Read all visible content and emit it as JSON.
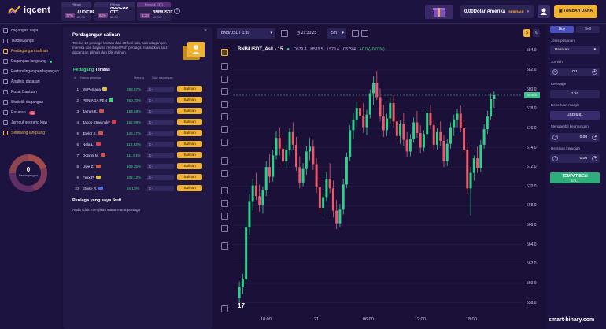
{
  "brand": {
    "name": "iqcent"
  },
  "asset_tabs": [
    {
      "header": "Pilihan",
      "pct": "77%",
      "name": "AUD/CHF",
      "sub": "60.00"
    },
    {
      "header": "Pilihan",
      "pct": "62%",
      "name": "AUD/CAD OTC",
      "sub": "60.00"
    },
    {
      "header": "Forex & CFD",
      "pct": "1:10",
      "name": "BNB/USDT",
      "sub": "60.00"
    }
  ],
  "account": {
    "balance": "0,00Dolar Amerika",
    "type": "SEBENAR"
  },
  "deposit_label": "TAMBAH DANA",
  "sidebar": {
    "items": [
      {
        "label": "dagangan saya"
      },
      {
        "label": "Turbo/Laings"
      },
      {
        "label": "Perdagangan salinan"
      },
      {
        "label": "Dagangan langsung"
      },
      {
        "label": "Pertandingan perdagangan"
      },
      {
        "label": "Analisis pasaran"
      },
      {
        "label": "Pusat Bantuan"
      },
      {
        "label": "Statistik dagangan"
      },
      {
        "label": "Pasaran",
        "badge": "99"
      },
      {
        "label": "Jemput seorang kaw"
      },
      {
        "label": "Sembang langsung"
      }
    ],
    "donut": {
      "value": "0",
      "label": "Perdagangan"
    }
  },
  "copy_panel": {
    "title": "Perdagangan salinan",
    "close": "×",
    "description": "Teroka 10 peniaga teratas dari 30 hari lalu, salin dagangan mereka dan bayaran mereka! Pilih peniaga, masukkan saiz dagangan pilihan dan klik salinan.",
    "top_prefix": "Pedagang",
    "top_suffix": "Teratas",
    "col_num": "#",
    "col_name": "Nama peniaga",
    "col_profit": "Untung",
    "col_size": "Saiz dagangan",
    "traders": [
      {
        "n": "1",
        "name": "x5 Peniaga",
        "flag": "#e0c23a",
        "profit": "298.57%",
        "size": "$ -",
        "btn": "Salinan"
      },
      {
        "n": "2",
        "name": "PENIAGA PEN",
        "flag": "#3bd87e",
        "profit": "260.70%",
        "size": "$ -",
        "btn": "Salinan"
      },
      {
        "n": "3",
        "name": "James K.",
        "flag": "#d8533c",
        "profit": "153.68%",
        "size": "$ -",
        "btn": "Salinan"
      },
      {
        "n": "4",
        "name": "Jacob Stravinsky",
        "flag": "#e23b3b",
        "profit": "152.98%",
        "size": "$ -",
        "btn": "Salinan"
      },
      {
        "n": "5",
        "name": "Taylor S.",
        "flag": "#d8533c",
        "profit": "145.27%",
        "size": "$ -",
        "btn": "Salinan"
      },
      {
        "n": "6",
        "name": "Nela L.",
        "flag": "#e04040",
        "profit": "118.53%",
        "size": "$ -",
        "btn": "Salinan"
      },
      {
        "n": "7",
        "name": "Donnel M.",
        "flag": "#d8533c",
        "profit": "111.91%",
        "size": "$ -",
        "btn": "Salinan"
      },
      {
        "n": "8",
        "name": "Uwe Z.",
        "flag": "#d8533c",
        "profit": "109.25%",
        "size": "$ -",
        "btn": "Salinan"
      },
      {
        "n": "9",
        "name": "Felix P.",
        "flag": "#e0c23a",
        "profit": "102.12%",
        "size": "$ -",
        "btn": "Salinan"
      },
      {
        "n": "10",
        "name": "Eloise R.",
        "flag": "#4a6fe0",
        "profit": "94.13%",
        "size": "$ -",
        "btn": "Salinan"
      }
    ],
    "mine_title": "Peniaga yang saya ikuti",
    "mine_empty": "Anda tidak mengikuti mana-mana peniaga"
  },
  "chart_toolbar": {
    "symbol": "BNB/USDT 1:10",
    "time": "21:30:25",
    "interval": "5m",
    "currency_a": "$",
    "currency_b": "€"
  },
  "chart_data": {
    "type": "candlestick",
    "title": "BNB/USDT_Ask - 15",
    "ohlc": {
      "o": "O579.4",
      "h": "H579.5",
      "l": "L579.4",
      "c": "C579.4",
      "chg": "+0.0 (+0.01%)"
    },
    "ylim": [
      557,
      585
    ],
    "yticks": [
      "584.0",
      "582.0",
      "580.0",
      "578.0",
      "576.0",
      "574.0",
      "572.0",
      "570.0",
      "568.0",
      "566.0",
      "564.0",
      "562.0",
      "560.0",
      "558.0"
    ],
    "xticks": [
      "18:00",
      "21",
      "06:00",
      "12:00",
      "18:00"
    ],
    "last_price": "579.4",
    "candles": [
      [
        558.5,
        560.2,
        557.8,
        559.6
      ],
      [
        559.6,
        561.0,
        558.9,
        560.4
      ],
      [
        560.4,
        566.5,
        560.0,
        565.8
      ],
      [
        565.8,
        569.2,
        565.0,
        568.4
      ],
      [
        568.4,
        570.8,
        567.5,
        570.1
      ],
      [
        570.1,
        571.4,
        568.6,
        569.0
      ],
      [
        569.0,
        570.2,
        567.4,
        568.1
      ],
      [
        568.1,
        570.0,
        567.2,
        569.6
      ],
      [
        569.6,
        572.6,
        569.0,
        572.0
      ],
      [
        572.0,
        573.3,
        570.4,
        571.0
      ],
      [
        571.0,
        573.8,
        570.5,
        573.2
      ],
      [
        573.2,
        575.7,
        572.8,
        575.0
      ],
      [
        575.0,
        576.1,
        573.2,
        573.9
      ],
      [
        573.9,
        575.2,
        572.1,
        572.6
      ],
      [
        572.6,
        574.3,
        571.9,
        573.8
      ],
      [
        573.8,
        576.0,
        573.2,
        575.6
      ],
      [
        575.6,
        576.6,
        573.8,
        574.3
      ],
      [
        574.3,
        575.1,
        571.6,
        572.0
      ],
      [
        572.0,
        573.1,
        569.8,
        570.4
      ],
      [
        570.4,
        572.4,
        570.0,
        571.8
      ],
      [
        571.8,
        574.2,
        571.2,
        573.6
      ],
      [
        573.6,
        575.0,
        572.7,
        574.1
      ],
      [
        574.1,
        574.8,
        571.7,
        572.3
      ],
      [
        572.3,
        572.9,
        569.3,
        569.9
      ],
      [
        569.9,
        571.0,
        567.2,
        567.8
      ],
      [
        567.8,
        569.5,
        567.0,
        568.9
      ],
      [
        568.9,
        571.5,
        568.4,
        570.8
      ],
      [
        570.8,
        572.4,
        569.3,
        569.8
      ],
      [
        569.8,
        570.6,
        566.8,
        567.5
      ],
      [
        567.5,
        568.6,
        565.6,
        566.2
      ],
      [
        566.2,
        568.2,
        565.8,
        567.6
      ],
      [
        567.6,
        570.8,
        567.1,
        570.2
      ],
      [
        570.2,
        573.5,
        569.8,
        573.0
      ],
      [
        573.0,
        576.3,
        572.6,
        575.8
      ],
      [
        575.8,
        577.6,
        574.9,
        576.9
      ],
      [
        576.9,
        578.8,
        576.2,
        578.1
      ],
      [
        578.1,
        579.5,
        576.9,
        577.3
      ],
      [
        577.3,
        578.6,
        575.5,
        576.1
      ],
      [
        576.1,
        577.9,
        575.3,
        577.4
      ],
      [
        577.4,
        580.0,
        577.0,
        579.6
      ],
      [
        579.6,
        581.4,
        578.4,
        580.7
      ],
      [
        580.7,
        581.9,
        578.9,
        579.2
      ],
      [
        579.2,
        580.1,
        576.7,
        577.2
      ],
      [
        577.2,
        578.4,
        575.1,
        575.8
      ],
      [
        575.8,
        577.5,
        575.2,
        577.0
      ],
      [
        577.0,
        579.2,
        576.5,
        578.6
      ],
      [
        578.6,
        579.4,
        576.1,
        576.7
      ],
      [
        576.7,
        577.3,
        574.6,
        575.2
      ],
      [
        575.2,
        576.8,
        574.4,
        576.4
      ],
      [
        576.4,
        577.6,
        574.2,
        574.8
      ],
      [
        574.8,
        575.6,
        573.0,
        573.6
      ],
      [
        573.6,
        575.4,
        573.1,
        574.9
      ],
      [
        574.9,
        577.1,
        574.5,
        576.6
      ],
      [
        576.6,
        577.8,
        575.0,
        575.5
      ],
      [
        575.5,
        576.3,
        573.4,
        574.0
      ],
      [
        574.0,
        575.8,
        573.6,
        575.4
      ],
      [
        575.4,
        578.1,
        575.0,
        577.6
      ],
      [
        577.6,
        578.4,
        575.9,
        576.3
      ],
      [
        576.3,
        576.9,
        573.7,
        574.3
      ],
      [
        574.3,
        576.0,
        573.8,
        575.6
      ],
      [
        575.6,
        576.7,
        574.2,
        574.7
      ],
      [
        574.7,
        575.3,
        572.0,
        572.6
      ],
      [
        572.6,
        574.9,
        572.1,
        574.4
      ],
      [
        574.4,
        576.6,
        573.9,
        576.1
      ],
      [
        576.1,
        577.4,
        575.2,
        576.9
      ],
      [
        576.9,
        578.0,
        576.1,
        577.5
      ],
      [
        577.5,
        578.3,
        575.6,
        576.0
      ],
      [
        576.0,
        576.8,
        573.2,
        573.8
      ],
      [
        573.8,
        574.5,
        569.2,
        569.8
      ],
      [
        569.8,
        572.0,
        567.0,
        571.4
      ],
      [
        571.4,
        573.2,
        570.6,
        572.9
      ],
      [
        572.9,
        574.1,
        571.4,
        571.9
      ],
      [
        571.9,
        574.8,
        571.5,
        574.3
      ],
      [
        574.3,
        576.4,
        573.9,
        575.9
      ],
      [
        575.9,
        577.8,
        575.4,
        577.2
      ],
      [
        577.2,
        579.6,
        576.8,
        579.0
      ],
      [
        579.0,
        579.8,
        578.1,
        579.4
      ]
    ]
  },
  "right_panel": {
    "buy": "Buy",
    "sell": "Sell",
    "order_type_label": "Jenis pesanan",
    "order_type": "Pasaran",
    "amount_label": "Jumlah",
    "amount": "0.1",
    "leverage_label": "Leverage",
    "leverage": "1:10",
    "margin_label": "Keperluan margin",
    "margin": "USD 5,81",
    "tp_label": "Mengambil keuntungan",
    "tp": "0.00",
    "sl_label": "Hentikan kerugian",
    "sl": "0.00",
    "buy_btn": "TEMPAT BELI",
    "buy_sub": "579.4"
  },
  "watermark": "smart-binary.com",
  "tv_logo": "17"
}
